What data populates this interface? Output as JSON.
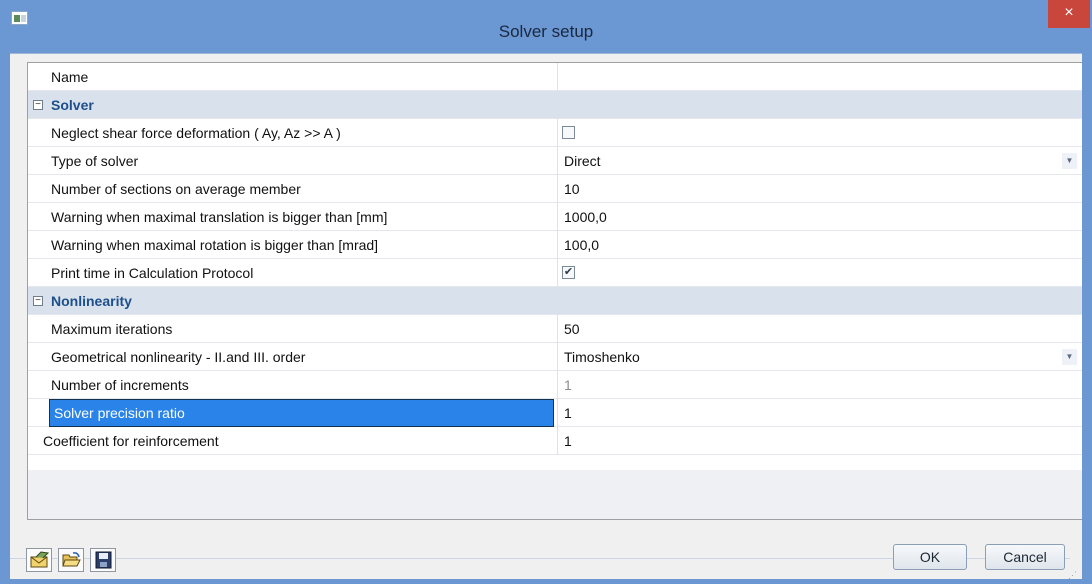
{
  "window": {
    "title": "Solver setup",
    "close_label": "×"
  },
  "grid": {
    "name_row": {
      "label": "Name",
      "value": ""
    },
    "solver_section": {
      "title": "Solver",
      "toggle": "−",
      "rows": {
        "neglect_shear": {
          "label": "Neglect shear force deformation ( Ay, Az >> A )",
          "checked": false
        },
        "type_of_solver": {
          "label": "Type of solver",
          "value": "Direct"
        },
        "num_sections": {
          "label": "Number of sections on average member",
          "value": "10"
        },
        "warn_translation": {
          "label": "Warning when maximal translation is bigger than [mm]",
          "value": "1000,0"
        },
        "warn_rotation": {
          "label": "Warning when maximal rotation is bigger than [mrad]",
          "value": "100,0"
        },
        "print_time": {
          "label": "Print time in Calculation Protocol",
          "checked": true,
          "check_glyph": "✔"
        }
      }
    },
    "nonlinearity_section": {
      "title": "Nonlinearity",
      "toggle": "−",
      "rows": {
        "max_iterations": {
          "label": "Maximum iterations",
          "value": "50"
        },
        "geom_nonlinearity": {
          "label": "Geometrical nonlinearity - II.and III. order",
          "value": "Timoshenko"
        },
        "num_increments": {
          "label": "Number of increments",
          "value": "1"
        },
        "precision_ratio": {
          "label": "Solver precision ratio",
          "value": "1"
        }
      }
    },
    "coefficient_row": {
      "label": "Coefficient for reinforcement",
      "value": "1"
    },
    "dropdown_glyph": "▼"
  },
  "footer": {
    "ok_label": "OK",
    "cancel_label": "Cancel",
    "grip_glyph": "⋰",
    "tools": [
      "default-settings-icon",
      "open-folder-icon",
      "save-disk-icon"
    ]
  },
  "colors": {
    "title_bar": "#6b97d2",
    "close_button": "#c9463d",
    "section_background": "#d9e2ec",
    "section_text": "#1d4f8a",
    "selection": "#2a83e8"
  }
}
